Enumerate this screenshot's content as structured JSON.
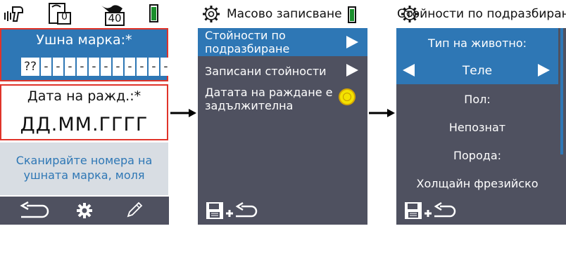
{
  "screen1": {
    "status": {
      "rfid_icon": "rfid-reader-icon",
      "counter_book": "0",
      "counter_cow": "40",
      "battery_color": "#1a8f2c"
    },
    "ear_tag": {
      "label": "Ушна марка:*",
      "first_cell": "??",
      "dash": "-",
      "dash_count": 11
    },
    "birth_date": {
      "label": "Дата на ражд.:*",
      "value": "ДД.ММ.ГГГГ"
    },
    "scan_message": {
      "line1": "Сканирайте номера на",
      "line2": "ушната марка, моля"
    },
    "footer_icons": [
      "back-arrow-icon",
      "gear-icon",
      "pencil-icon"
    ]
  },
  "screen2": {
    "title": "Масово записване",
    "items": [
      {
        "line1": "Стойности по",
        "line2": "подразбиране"
      },
      {
        "line1": "Записани стойности"
      },
      {
        "line1": "Датата на раждане е",
        "line2": "задължителна"
      }
    ]
  },
  "screen3": {
    "title": "Стойности по подразбиране",
    "animal_type_label": "Тип на животно:",
    "animal_type_value": "Теле",
    "sex_label": "Пол:",
    "sex_value": "Непознат",
    "breed_label": "Порода:",
    "breed_value": "Холщайн фрезийско"
  },
  "colors": {
    "blue": "#2e77b5",
    "dark": "#4f5160",
    "red": "#e0342a",
    "light": "#d8dde3",
    "yellow": "#f3e200"
  }
}
